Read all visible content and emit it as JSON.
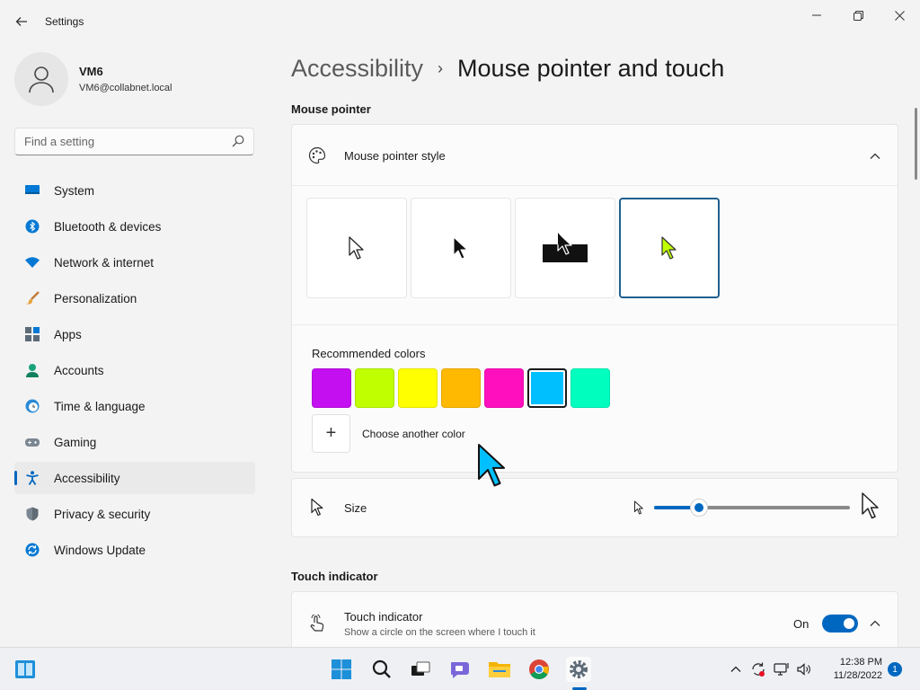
{
  "window": {
    "title": "Settings",
    "back_icon": "back-arrow-icon",
    "controls": [
      "minimize-icon",
      "maximize-icon",
      "close-icon"
    ]
  },
  "profile": {
    "name": "VM6",
    "email": "VM6@collabnet.local"
  },
  "search": {
    "placeholder": "Find a setting"
  },
  "sidebar": {
    "items": [
      {
        "label": "System",
        "icon": "system-monitor-icon",
        "active": false
      },
      {
        "label": "Bluetooth & devices",
        "icon": "bluetooth-icon",
        "active": false
      },
      {
        "label": "Network & internet",
        "icon": "wifi-icon",
        "active": false
      },
      {
        "label": "Personalization",
        "icon": "paintbrush-icon",
        "active": false
      },
      {
        "label": "Apps",
        "icon": "apps-icon",
        "active": false
      },
      {
        "label": "Accounts",
        "icon": "accounts-icon",
        "active": false
      },
      {
        "label": "Time & language",
        "icon": "clock-globe-icon",
        "active": false
      },
      {
        "label": "Gaming",
        "icon": "gamepad-icon",
        "active": false
      },
      {
        "label": "Accessibility",
        "icon": "accessibility-icon",
        "active": true
      },
      {
        "label": "Privacy & security",
        "icon": "shield-icon",
        "active": false
      },
      {
        "label": "Windows Update",
        "icon": "update-icon",
        "active": false
      }
    ]
  },
  "breadcrumb": {
    "parent": "Accessibility",
    "separator": "›",
    "current": "Mouse pointer and touch"
  },
  "mouse_pointer": {
    "section_title": "Mouse pointer",
    "style_card": {
      "label": "Mouse pointer style",
      "expanded": true,
      "options": [
        {
          "name": "white",
          "selected": false
        },
        {
          "name": "black",
          "selected": false
        },
        {
          "name": "inverted",
          "selected": false
        },
        {
          "name": "custom",
          "selected": true
        }
      ],
      "recommended_colors_label": "Recommended colors",
      "colors": [
        "#c40ff0",
        "#bfff00",
        "#ffff00",
        "#ffb900",
        "#ff0fbe",
        "#00bfff",
        "#00ffbf"
      ],
      "selected_color_index": 5,
      "choose_color_label": "Choose another color",
      "add_symbol": "+"
    },
    "size": {
      "label": "Size",
      "value_fraction": 0.23
    }
  },
  "touch": {
    "section_title": "Touch indicator",
    "label": "Touch indicator",
    "description": "Show a circle on the screen where I touch it",
    "state_label": "On",
    "enabled": true
  },
  "taskbar": {
    "apps": [
      "widgets-icon",
      "windows-start-icon",
      "search-icon",
      "task-view-icon",
      "chat-icon",
      "file-explorer-icon",
      "chrome-icon",
      "settings-gear-icon"
    ],
    "active_app": "settings-gear-icon",
    "time": "12:38 PM",
    "date": "11/28/2022",
    "notification_count": "1"
  },
  "colors": {
    "accent": "#0067c0",
    "selected_pointer": "#bfff00",
    "cursor_fill": "#00bfff"
  }
}
